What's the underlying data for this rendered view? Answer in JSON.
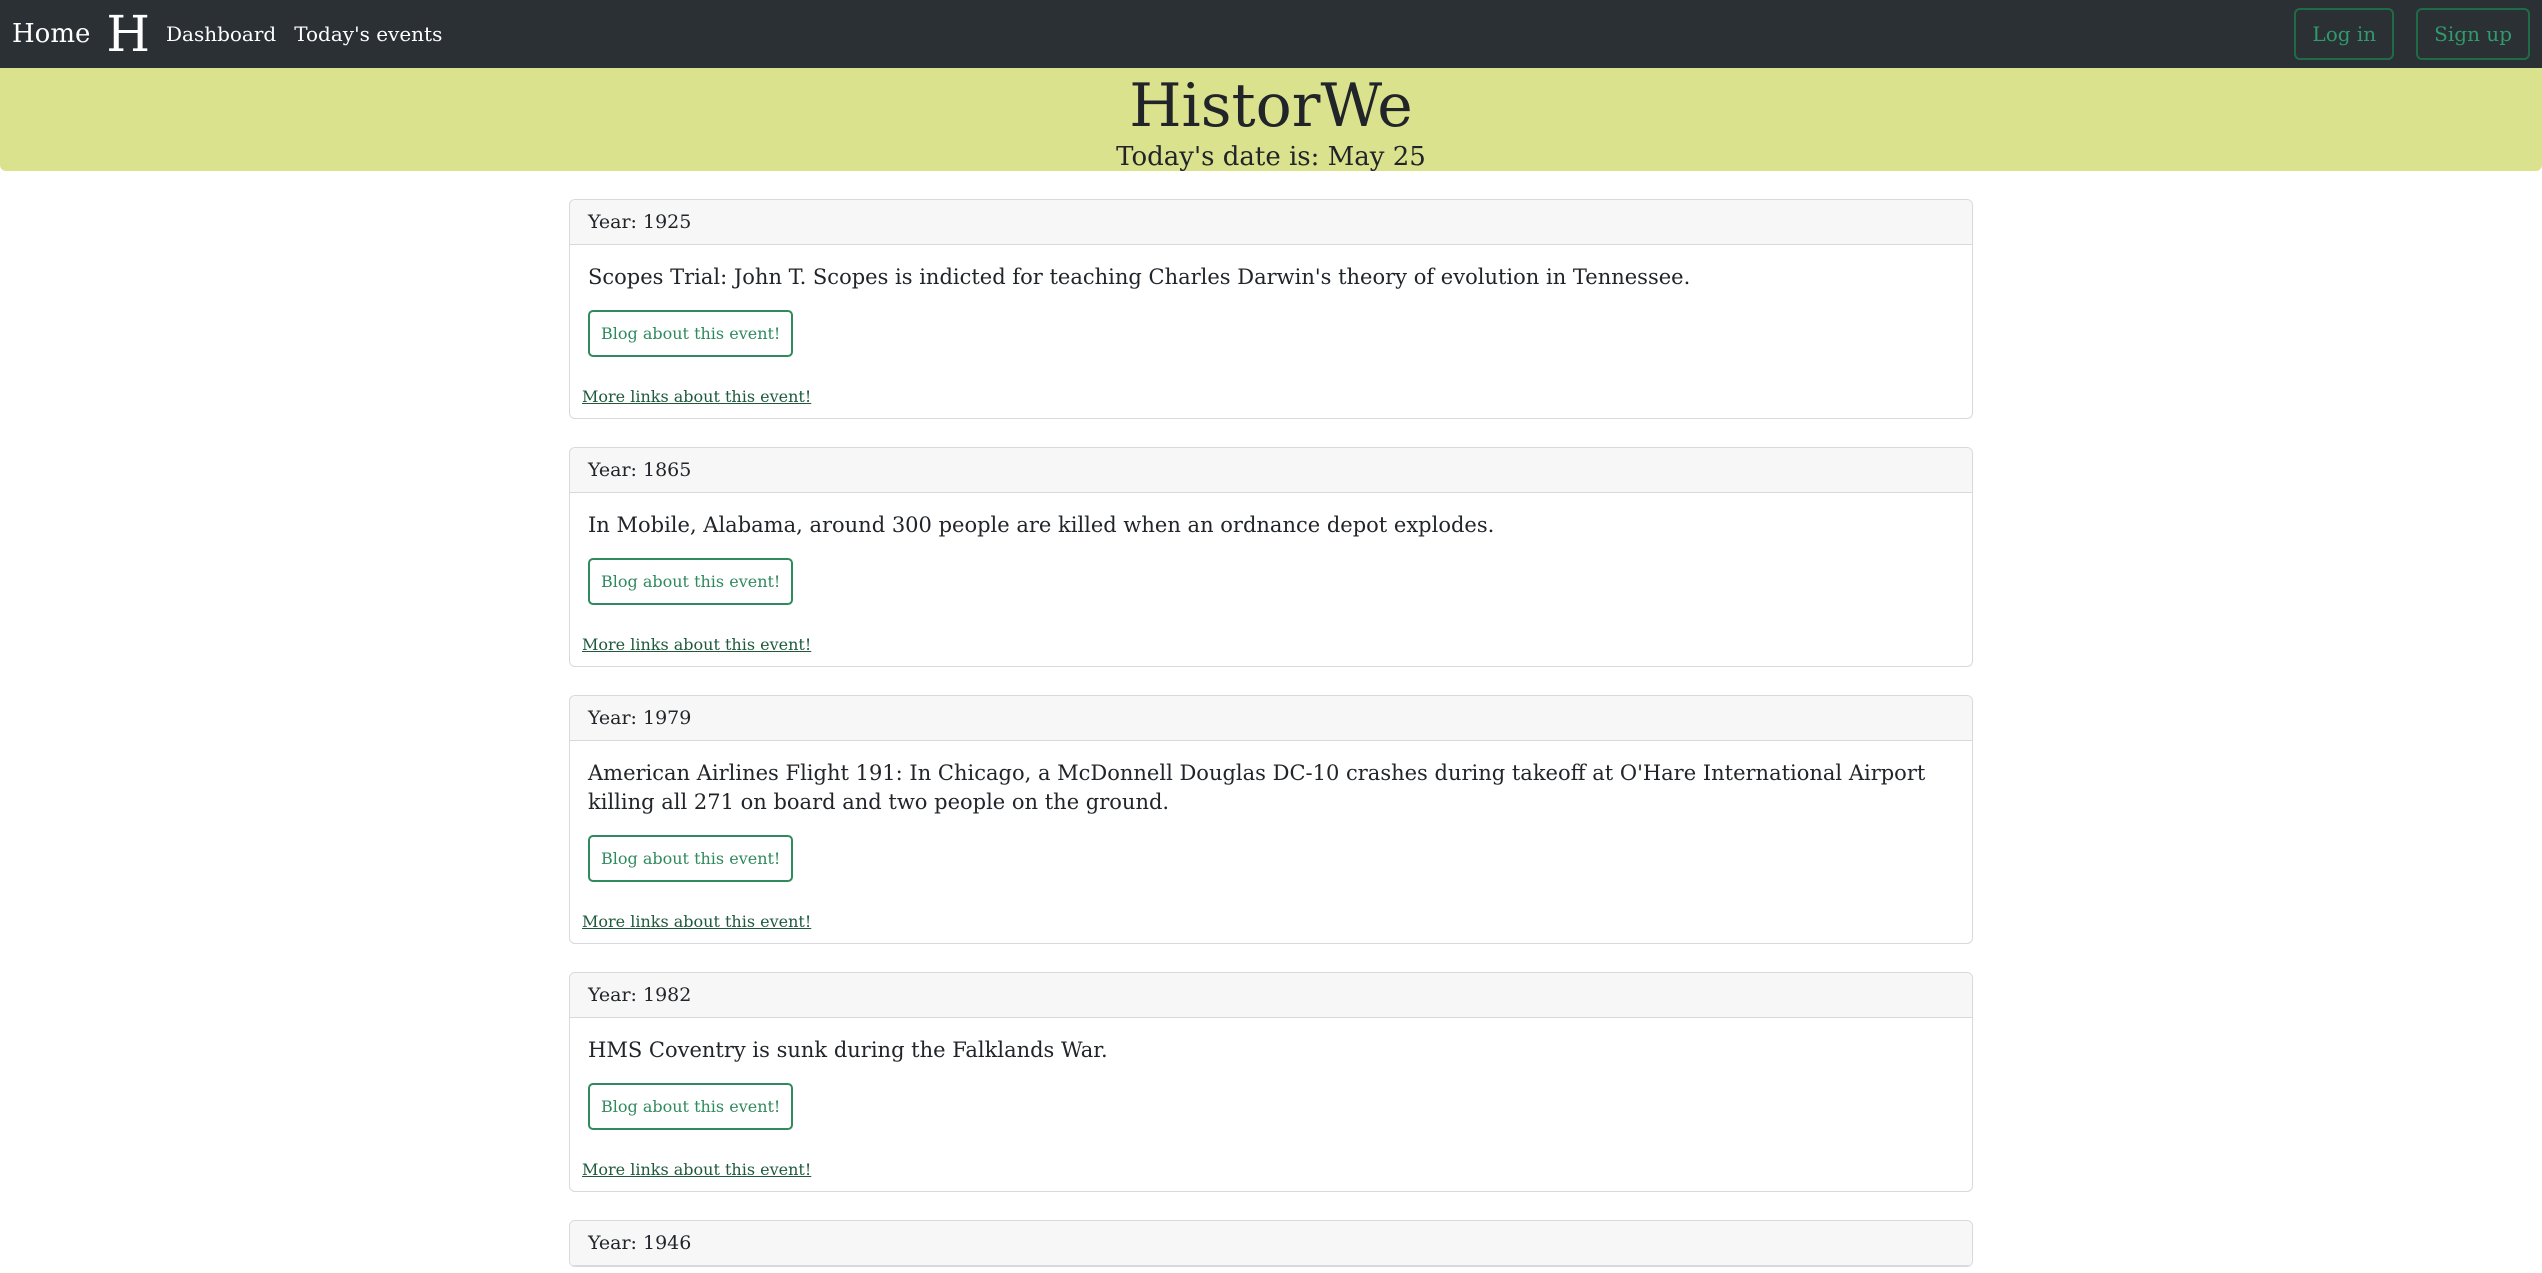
{
  "nav": {
    "home": "Home",
    "logo": "H",
    "dashboard": "Dashboard",
    "todays_events": "Today's events",
    "login": "Log in",
    "signup": "Sign up"
  },
  "hero": {
    "title": "HistorWe",
    "date_line": "Today's date is: May 25"
  },
  "events": [
    {
      "year": "Year: 1925",
      "text": "Scopes Trial: John T. Scopes is indicted for teaching Charles Darwin's theory of evolution in Tennessee.",
      "blog": "Blog about this event!",
      "more": "More links about this event!"
    },
    {
      "year": "Year: 1865",
      "text": "In Mobile, Alabama, around 300 people are killed when an ordnance depot explodes.",
      "blog": "Blog about this event!",
      "more": "More links about this event!"
    },
    {
      "year": "Year: 1979",
      "text": "American Airlines Flight 191: In Chicago, a McDonnell Douglas DC-10 crashes during takeoff at O'Hare International Airport killing all 271 on board and two people on the ground.",
      "blog": "Blog about this event!",
      "more": "More links about this event!"
    },
    {
      "year": "Year: 1982",
      "text": "HMS Coventry is sunk during the Falklands War.",
      "blog": "Blog about this event!",
      "more": "More links about this event!"
    },
    {
      "year": "Year: 1946"
    }
  ],
  "colors": {
    "navbar_bg": "#2b3035",
    "hero_bg": "#dbe28d",
    "accent_green": "#2f8a5e"
  }
}
